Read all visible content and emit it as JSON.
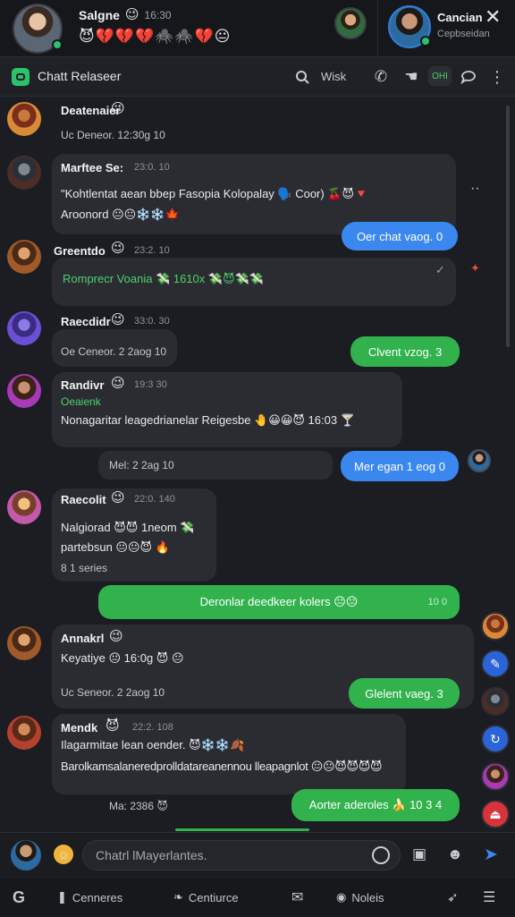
{
  "header": {
    "contact_left": {
      "name": "Salgne",
      "status_emoji": "😉",
      "time": "16:30",
      "emoji_row": "😈💔💔💔🕷️🕷️💔😐"
    },
    "contact_right": {
      "name": "Cancian",
      "subtitle": "Cepbseidan"
    },
    "close_icon": "✕"
  },
  "subheader": {
    "title": "Chatt Relaseer",
    "search_label": "Wisk",
    "icons": [
      "search-icon",
      "phone-icon",
      "reaction-icon",
      "tag-icon",
      "chat-icon",
      "more-icon"
    ],
    "tag_label": "OHI"
  },
  "messages": [
    {
      "sender": "Deatenaier",
      "emoji": "😉",
      "lines": [
        "Uc Deneor.   12:30g 10"
      ]
    },
    {
      "sender": "Marftee Se:",
      "time": "23:0. 10",
      "lines": [
        "\"Kohtlentat aean bbep Fasopia Kolopalay 🗣️ Coor) 🍒😈🔻",
        "Aroonord 😐😐❄️❄️🍁"
      ]
    },
    {
      "sender": "Greentdo",
      "emoji": "😉",
      "time": "23:2. 10",
      "lines": [
        "Romprecr Voania 💸 1610x 💸😈💸💸"
      ]
    },
    {
      "sender": "Raecdidr",
      "emoji": "😉",
      "time": "33:0. 30",
      "lines": [
        "Oe Ceneor.  2 2aog 10"
      ]
    },
    {
      "sender": "Randivr",
      "emoji": "😉",
      "time": "19:3 30",
      "sub": "Oeaienk",
      "lines": [
        "Nonagaritar leagedrianelar Reigesbe 🤚😀😀😈 16:03 🍸"
      ]
    },
    {
      "sender": "Raecolit",
      "emoji": "😉",
      "time": "22:0. 140",
      "lines": [
        "Nalgiorad 😈😈 1neom 💸",
        "partebsun 😐😐😈 🔥",
        "8 1 series"
      ]
    },
    {
      "sender": "Annakrl",
      "emoji": "😉",
      "lines": [
        "Keyatiye 😐 16:0g 😈 😐",
        "Uc Seneor.  2 2aog 10"
      ]
    },
    {
      "sender": "Mendk",
      "emoji": "😈",
      "time": "22:2. 108",
      "lines": [
        "Ilagarmitae lean oender. 😈❄️❄️🍂",
        "Barolkamsalaneredprolldatareanennou lleapagnlot 😐😐😈😈😈😈",
        "Ma: 2386 😈"
      ]
    }
  ],
  "outgoing": [
    {
      "text": "Oer chat vaog.  0",
      "color": "blue"
    },
    {
      "text": "Clvent vzog.  3",
      "color": "green"
    },
    {
      "text": "Mer egan 1 eog  0",
      "color": "blue"
    },
    {
      "text": "Deronlar deedkeer kolers 😐😐",
      "time": "10 0",
      "color": "green"
    },
    {
      "text": "Glelent vaeg.  3",
      "color": "green"
    },
    {
      "text": "Aorter aderoles 🍌 10 3 4",
      "color": "green"
    }
  ],
  "misc": {
    "reply_time": "Mel: 2 2ag 10",
    "more_dots": "··"
  },
  "composer": {
    "placeholder": "Chatrl lMayerlantes."
  },
  "nav": {
    "items": [
      "Cenneres",
      "Centiurce",
      "Noleis"
    ]
  },
  "colors": {
    "blue": "#3b87f0",
    "green": "#31b24d",
    "background": "#1b1d22",
    "bubble": "#2a2c31"
  }
}
